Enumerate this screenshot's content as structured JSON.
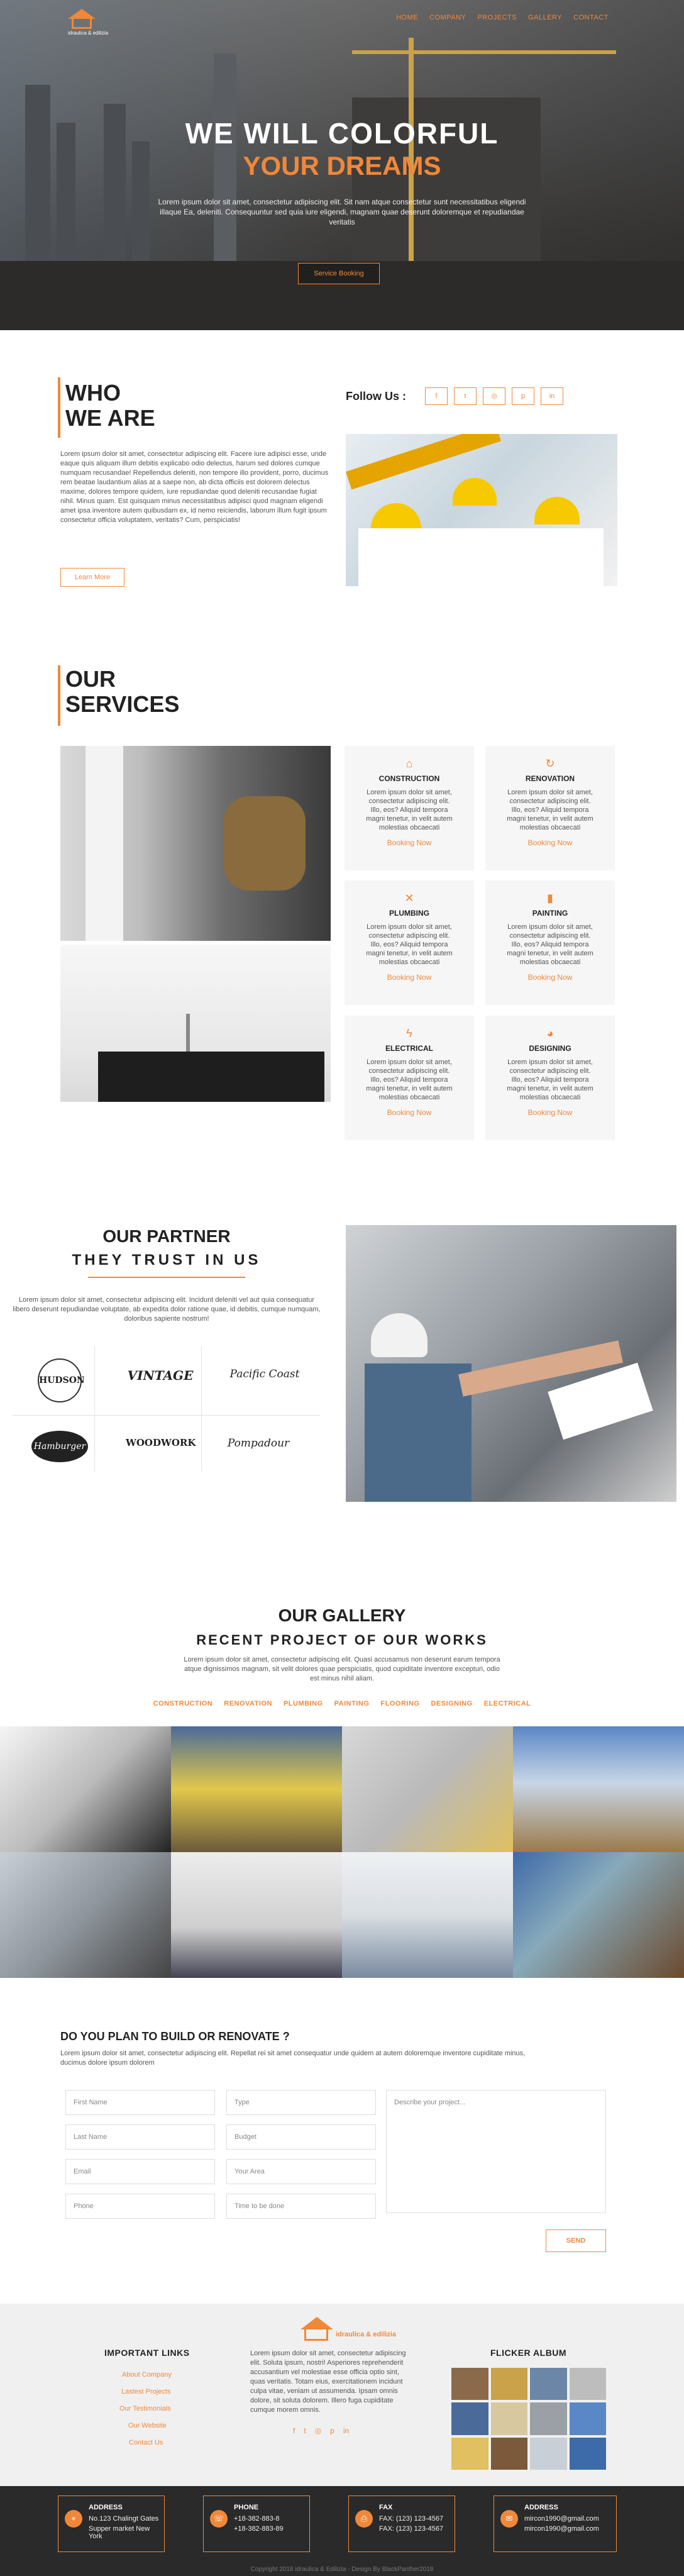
{
  "nav": {
    "items": [
      "HOME",
      "COMPANY",
      "PROJECTS",
      "GALLERY",
      "CONTACT"
    ]
  },
  "brand": {
    "name": "idraulica & edilizia",
    "accent": "#f0883a"
  },
  "hero": {
    "title": "WE WILL COLORFUL",
    "subtitle": "YOUR DREAMS",
    "text": "Lorem ipsum dolor sit amet, consectetur adipiscing elit. Sit nam atque consectetur sunt necessitatibus eligendi illaque Ea, deleniti. Consequuntur sed quia iure eligendi, magnam quae deserunt doloremque et repudiandae veritatis",
    "button": "Service Booking"
  },
  "who": {
    "title_line1": "WHO",
    "title_line2": "WE ARE",
    "text": "Lorem ipsum dolor sit amet, consectetur adipiscing elit. Facere iure adipisci esse, unde eaque quis aliquam illum debitis explicabo odio delectus, harum sed dolores cumque numquam recusandae! Repellendus deleniti, non tempore illo provident, porro, ducimus rem beatae laudantium alias at a saepe non, ab dicta officiis est dolorem delectus maxime, dolores tempore quidem, iure repudiandae quod deleniti recusandae fugiat nihil. Minus quam. Est quisquam minus necessitatibus adipisci quod magnam eligendi amet ipsa inventore autem quibusdam ex, id nemo reiciendis, laborum illum fugit ipsum consectetur officia voluptatem, veritatis? Cum, perspiciatis!",
    "button": "Learn More",
    "follow": "Follow Us :",
    "social": [
      "f",
      "t",
      "◎",
      "p",
      "in"
    ]
  },
  "services": {
    "title_line1": "OUR",
    "title_line2": "SERVICES",
    "cards": [
      {
        "icon": "house-icon",
        "glyph": "⌂",
        "title": "CONSTRUCTION",
        "text": "Lorem ipsum dolor sit amet, consectetur adipiscing elit. Illo, eos? Aliquid tempora magni tenetur, in velit autem molestias obcaecati",
        "button": "Booking Now"
      },
      {
        "icon": "refresh-icon",
        "glyph": "↻",
        "title": "RENOVATION",
        "text": "Lorem ipsum dolor sit amet, consectetur adipiscing elit. Illo, eos? Aliquid tempora magni tenetur, in velit autem molestias obcaecati",
        "button": "Booking Now"
      },
      {
        "icon": "wrench-icon",
        "glyph": "✕",
        "title": "PLUMBING",
        "text": "Lorem ipsum dolor sit amet, consectetur adipiscing elit. Illo, eos? Aliquid tempora magni tenetur, in velit autem molestias obcaecati",
        "button": "Booking Now"
      },
      {
        "icon": "paint-roller-icon",
        "glyph": "▮",
        "title": "PAINTING",
        "text": "Lorem ipsum dolor sit amet, consectetur adipiscing elit. Illo, eos? Aliquid tempora magni tenetur, in velit autem molestias obcaecati",
        "button": "Booking Now"
      },
      {
        "icon": "bolt-icon",
        "glyph": "ϟ",
        "title": "ELECTRICAL",
        "text": "Lorem ipsum dolor sit amet, consectetur adipiscing elit. Illo, eos? Aliquid tempora magni tenetur, in velit autem molestias obcaecati",
        "button": "Booking Now"
      },
      {
        "icon": "palette-icon",
        "glyph": "◕",
        "title": "DESIGNING",
        "text": "Lorem ipsum dolor sit amet, consectetur adipiscing elit. Illo, eos? Aliquid tempora magni tenetur, in velit autem molestias obcaecati",
        "button": "Booking Now"
      }
    ]
  },
  "partner": {
    "title": "OUR PARTNER",
    "subtitle": "THEY TRUST IN US",
    "text": "Lorem ipsum dolor sit amet, consectetur adipiscing elit. Incidunt deleniti vel aut quia consequatur libero deserunt repudiandae voluptate, ab expedita dolor ratione quae, id debitis, cumque numquam, doloribus sapiente nostrum!",
    "logos": [
      "HUDSON",
      "VINTAGE",
      "Pacific Coast",
      "Hamburger",
      "WOODWORK",
      "Pompadour"
    ]
  },
  "gallery": {
    "title": "OUR GALLERY",
    "subtitle": "RECENT PROJECT OF OUR WORKS",
    "text": "Lorem ipsum dolor sit amet, consectetur adipiscing elit. Quasi accusamus non deserunt earum tempora atque dignissimos magnam, sit velit dolores quae perspiciatis, quod cupiditate inventore excepturi, odio est minus nihil aliam.",
    "filters": [
      "CONSTRUCTION",
      "RENOVATION",
      "PLUMBING",
      "PAINTING",
      "FLOORING",
      "DESIGNING",
      "ELECTRICAL"
    ]
  },
  "plan": {
    "title": "DO YOU PLAN TO BUILD OR RENOVATE ?",
    "text": "Lorem ipsum dolor sit amet, consectetur adipiscing elit. Repellat rei sit amet consequatur unde quidem at autem doloremque inventore cupiditate minus, ducimus dolore ipsum dolorem",
    "fields": {
      "first_name": "First Name",
      "type": "Type",
      "describe": "Describe your project...",
      "last_name": "Last Name",
      "budget": "Budget",
      "email": "Email",
      "area": "Your Area",
      "phone": "Phone",
      "time": "Time to be done"
    },
    "send": "SEND"
  },
  "footer": {
    "links_title": "IMPORTANT LINKS",
    "links": [
      "About Company",
      "Lastest Projects",
      "Our Testimonials",
      "Our Website",
      "Contact Us"
    ],
    "about": "Lorem ipsum dolor sit amet, consectetur adipiscing elit. Soluta ipsum, nostri! Asperiores reprehenderit accusantium vel molestiae esse officia optio sint, quas veritatis. Totam eius, exercitationem incidunt culpa vitae, veniam ut assumenda. Ipsam omnis dolore, sit soluta dolorem. Illero fuga cupiditate cumque morem omnis.",
    "flicker_title": "FLICKER ALBUM",
    "social": [
      "f",
      "t",
      "◎",
      "p",
      "in"
    ]
  },
  "contact": [
    {
      "title": "ADDRESS",
      "line1": "No.123 Chalingt Gates",
      "line2": "Supper market New York",
      "icon": "map-pin-icon"
    },
    {
      "title": "PHONE",
      "line1": "+18-382-883-8",
      "line2": "+18-382-883-89",
      "icon": "phone-icon"
    },
    {
      "title": "FAX",
      "line1": "FAX: (123) 123-4567",
      "line2": "FAX: (123) 123-4567",
      "icon": "fax-icon"
    },
    {
      "title": "ADDRESS",
      "line1": "mircon1990@gmail.com",
      "line2": "mircon1990@gmail.com",
      "icon": "mail-icon"
    }
  ],
  "copyright": "Copyright 2018 idraulica & Edilizia - Design By BlackPanther2018"
}
